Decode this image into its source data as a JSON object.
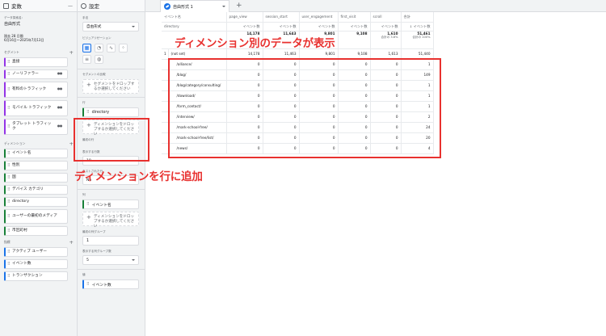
{
  "variables_panel": {
    "title": "変数",
    "exploration_name_label": "データ探索名：",
    "exploration_name": "自由形式",
    "date_range_label": "過去 28 日間",
    "date_range": "6月16日〜2025年7月13日",
    "segments_title": "セグメント",
    "segments": [
      "直接",
      "ノーリファラー",
      "有料のトラフィック",
      "モバイル トラフィック",
      "タブレット トラフィック"
    ],
    "dimensions_title": "ディメンション",
    "dimensions": [
      "イベント名",
      "性別",
      "国",
      "デバイス カテゴリ",
      "directory",
      "ユーザーの最初のメディア",
      "市区町村"
    ],
    "metrics_title": "指標",
    "metrics": [
      "アクティブ ユーザー",
      "イベント数",
      "トランザクション"
    ]
  },
  "settings_panel": {
    "title": "設定",
    "technique_label": "手法",
    "technique_value": "自由形式",
    "visualization_label": "ビジュアリゼーション",
    "viz_icons": [
      "table-icon",
      "donut-icon",
      "line-icon",
      "scatter-icon",
      "bar-icon",
      "globe-icon"
    ],
    "segment_compare_label": "セグメントの比較",
    "segment_drop": "セグメントをドロップするか選択してください",
    "rows_label": "行",
    "row_chip": "directory",
    "row_drop": "ディメンションをドロップするか選択してください",
    "start_row_label": "最初の行",
    "rows_per_page_label": "表示する行数",
    "rows_per_page": "10",
    "nested_rows_label": "ネストされた行",
    "nested_rows": "No",
    "columns_label": "列",
    "column_chip": "イベント名",
    "column_drop": "ディメンションをドロップするか選択してください",
    "first_col_group_label": "最初の列グループ",
    "first_col_group": "1",
    "col_groups_label": "表示する列グループ数",
    "col_groups": "5",
    "values_label": "値",
    "value_chip": "イベント数"
  },
  "main": {
    "tab_name": "自由形式 1",
    "table": {
      "corner_event_label": "イベント名",
      "corner_dim_label": "directory",
      "event_columns": [
        "page_view",
        "session_start",
        "user_engagement",
        "first_visit",
        "scroll",
        "合計"
      ],
      "metric_label": "イベント数",
      "total_metric_label": "↓ イベント数",
      "totals": [
        "14,178",
        "11,643",
        "9,801",
        "9,108",
        "1,610",
        "51,461"
      ],
      "totals_pct": [
        "",
        "",
        "",
        "",
        "合計の 3.8%",
        "合計の 100%"
      ],
      "not_set_row": {
        "idx": "1",
        "name": "(not set)",
        "values": [
          "14,178",
          "11,463",
          "9,801",
          "9,108",
          "1,613",
          "51,440"
        ]
      },
      "rows": [
        {
          "name": "/alliance/",
          "values": [
            "0",
            "0",
            "0",
            "0",
            "0",
            "1"
          ]
        },
        {
          "name": "/blog/",
          "values": [
            "0",
            "0",
            "0",
            "0",
            "0",
            "149"
          ]
        },
        {
          "name": "/blog/category/consulting/",
          "values": [
            "0",
            "0",
            "0",
            "0",
            "0",
            "1"
          ]
        },
        {
          "name": "/download/",
          "values": [
            "0",
            "0",
            "0",
            "0",
            "0",
            "1"
          ]
        },
        {
          "name": "/form_contact/",
          "values": [
            "0",
            "0",
            "0",
            "0",
            "0",
            "1"
          ]
        },
        {
          "name": "/interview/",
          "values": [
            "0",
            "0",
            "0",
            "0",
            "0",
            "2"
          ]
        },
        {
          "name": "/mark-school-free/",
          "values": [
            "0",
            "0",
            "0",
            "0",
            "0",
            "24"
          ]
        },
        {
          "name": "/mark-school-free/list/",
          "values": [
            "0",
            "0",
            "0",
            "0",
            "0",
            "20"
          ]
        },
        {
          "name": "/news/",
          "values": [
            "0",
            "0",
            "0",
            "0",
            "0",
            "4"
          ]
        }
      ]
    }
  },
  "annotations": {
    "top": "ディメンション別のデータが表示",
    "bottom": "ディメンションを行に追加",
    "color": "#e8312f"
  }
}
